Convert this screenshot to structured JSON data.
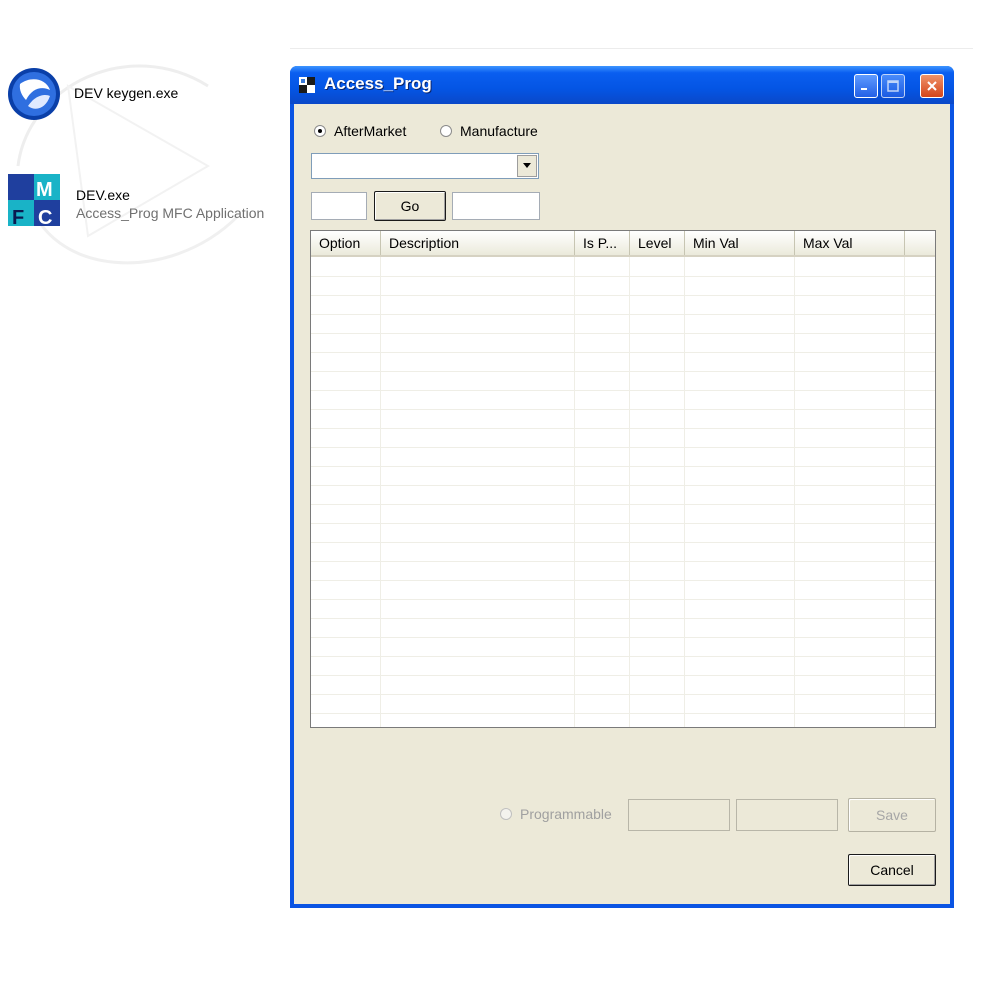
{
  "desktop": {
    "icons": [
      {
        "name": "DEV keygen.exe",
        "subtitle": ""
      },
      {
        "name": "DEV.exe",
        "subtitle": "Access_Prog MFC Application"
      }
    ]
  },
  "window": {
    "title": "Access_Prog",
    "colors": {
      "titlebar": "#0a54e3",
      "client": "#ece9d8",
      "close": "#d3451a"
    },
    "mode_options": [
      {
        "label": "AfterMarket",
        "selected": true
      },
      {
        "label": "Manufacture",
        "selected": false
      }
    ],
    "dropdown": {
      "value": ""
    },
    "left_input": {
      "value": ""
    },
    "go_label": "Go",
    "right_input": {
      "value": ""
    },
    "table": {
      "columns": [
        "Option",
        "Description",
        "Is P...",
        "Level",
        "Min Val",
        "Max Val"
      ],
      "rows": []
    },
    "programmable_label": "Programmable",
    "programmable_selected": false,
    "save_label": "Save",
    "cancel_label": "Cancel"
  }
}
